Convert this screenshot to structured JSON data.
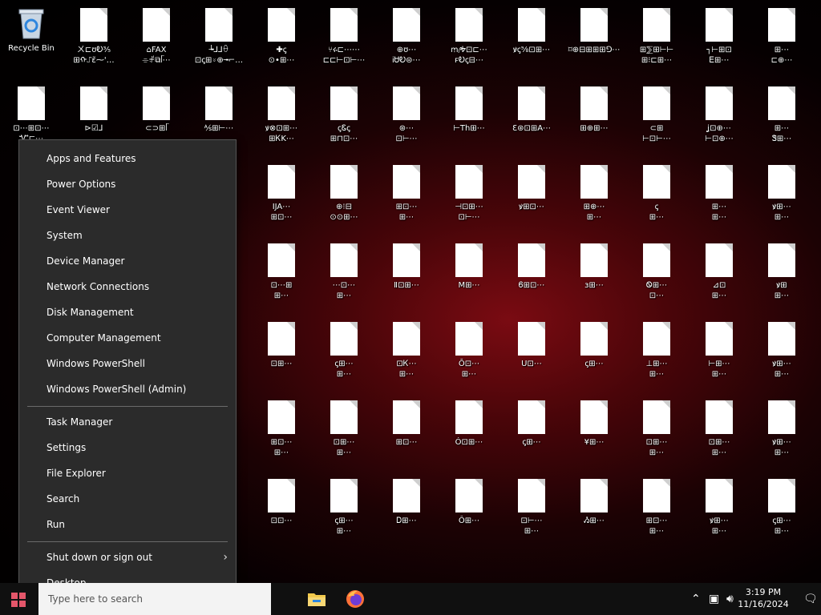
{
  "desktop": {
    "recycle_bin_label": "Recycle Bin",
    "files": [
      [
        "ㄨ⊏ʊᎧ⅗\n⊞ᠬ⑀ɛ̃⁓'…",
        "⌂FAX\n⌯ꂱ⧉ᥬ⋯",
        "┶⅃⅃ꂶ\n⊡ꞔ⊞⍤⊕╼⌐…",
        "✚ꞔ\n⊙•⊞⋯",
        "⑂ሩ⊏⋯⋯\n⊏⊏⊢⊡⊢⋯",
        "⊕ʊ⋯\nᎥᏌᎧ⊜⋯",
        "ꭑⱼᎭ⊡⊏⋯\nꜰᎧꞔ⊟⋯",
        "ꝟꞔ⅝⊡⊞⋯",
        "⌑⊕⊟⊞⊞⊞⅁⋯",
        "⊞⅀⊞⊢⊢\n⊞⁝⊏⊞⋯",
        "┐⊢⊞⊡\nᎬ⊞⋯",
        "⊞⋯\n⊏⊕⋯"
      ],
      [
        "⊡⋯⊞⊡⋯\nᏉ⊏⋯",
        "⊳☑⅃\n",
        "⊂⊃⊞ᥬ\n",
        "⅍⊞⊢⋯\n",
        "ꝟ⊗⊡⊞⋯\n⊞ᏦK⋯",
        "ꞔᏋꞔ\n⊞⊓⊡⋯",
        "⊛⋯\n⊡⊢⋯",
        "⊢Th⊞⋯",
        "Ɛ⊛⊡⊞A⋯",
        "⊞⊕⊞⋯",
        "⊂⊞\n⊢⊡⊢⋯",
        "ʝ⊡⊕⋯\n⊢⊡⊕⋯",
        "⊞⋯\nᏕ⊞⋯"
      ],
      [
        "⊞⋯",
        "",
        "⋯",
        "IJA⋯\n⊞⊡⋯",
        "⊕⁝⊟\n⊙⊙⊞⋯",
        "⊞⊡⋯\n⊞⋯",
        "⊣⊡⊞⋯\n⊡⊢⋯",
        "ꝟ⊞⊡⋯",
        "⊞⊕⋯\n⊞⋯",
        "ꞔ\n⊞⋯",
        "⊞⋯\n⊞⋯",
        "ꝟ⊞⋯\n⊞⋯"
      ],
      [
        "⊞⋯",
        "⋯",
        "⊞⋯",
        "⊡⋯⊞\n⊞⋯",
        "⋯⊡⋯\n⊞⋯",
        "Ⅱ⊡⊞⋯",
        "M⊞⋯",
        "Ꮾ⊞⊡⋯",
        "ɜ⊞⋯",
        "Ꮻ⊞⋯\n⊡⋯",
        "⊿⊡\n⊞⋯",
        "ꝟ⊞\n⊞⋯"
      ],
      [
        "⊞⋯",
        "⋯",
        "⋯",
        "⊡⊞⋯",
        "ꞔ⊞⋯\n⊞⋯",
        "⊡Ꮶ⋯\n⊞⋯",
        "Ŏ⊡⋯\n⊞⋯",
        "U⊡⋯",
        "ꞔ⊞⋯",
        "⊥⊞⋯\n⊞⋯",
        "⊢⊞⋯\n⊞⋯",
        "ꝟ⊞⋯\n⊞⋯"
      ],
      [
        "⊞⋯",
        "⋯",
        "⋯",
        "⊞⊡⋯\n⊞⋯",
        "⊡⊞⋯\n⊞⋯",
        "⊞⊡⋯",
        "Ó⊡⊞⋯",
        "ꞔ⊞⋯",
        "¥⊞⋯",
        "⊡⊞⋯\n⊞⋯",
        "⊡⊞⋯\n⊞⋯",
        "ꝟ⊞⋯\n⊞⋯"
      ],
      [
        "⊞⋯",
        "⋯",
        "⋯",
        "⊡⊡⋯",
        "ꞔ⊞⋯\n⊞⋯",
        "Ꭰ⊞⋯",
        "Ô⊞⋯",
        "⊡⊢⋯\n⊞⋯",
        "Ᏹ⊞⋯",
        "⊞⊡⋯\n⊞⋯",
        "ꝟ⊞⋯\n⊞⋯",
        "ꞔ⊞⋯\n⊞⋯"
      ]
    ]
  },
  "start_menu": {
    "group1": [
      "Apps and Features",
      "Power Options",
      "Event Viewer",
      "System",
      "Device Manager",
      "Network Connections",
      "Disk Management",
      "Computer Management",
      "Windows PowerShell",
      "Windows PowerShell (Admin)"
    ],
    "group2": [
      "Task Manager",
      "Settings",
      "File Explorer",
      "Search",
      "Run"
    ],
    "group3": [
      "Shut down or sign out",
      "Desktop"
    ],
    "submenu_icon": "chevron-right-icon"
  },
  "taskbar": {
    "search_placeholder": "Type here to search",
    "apps": [
      "file-explorer-icon",
      "firefox-icon"
    ],
    "tray": {
      "time": "3:19 PM",
      "date": "11/16/2024",
      "icons": [
        "chevron-up-icon",
        "network-icon",
        "volume-icon",
        "notification-icon"
      ]
    }
  },
  "colors": {
    "start_accent": "#e4566a",
    "menu_bg": "#2b2b2b",
    "taskbar_bg": "#101010"
  }
}
